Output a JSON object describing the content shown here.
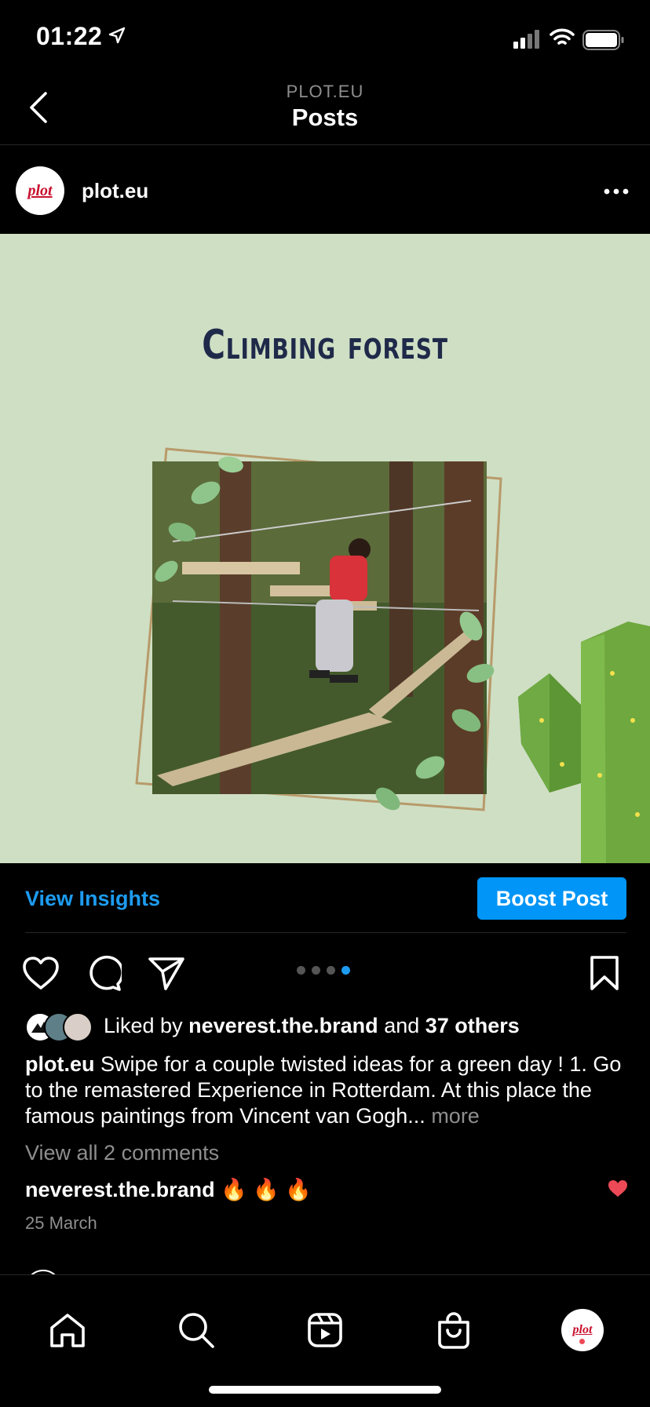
{
  "status_bar": {
    "time": "01:22"
  },
  "header": {
    "subtitle": "PLOT.EU",
    "title": "Posts"
  },
  "post": {
    "username": "plot.eu",
    "avatar_logo": "plot",
    "image_title": "Climbing forest",
    "insights_label": "View Insights",
    "boost_label": "Boost Post",
    "carousel": {
      "count": 4,
      "active_index": 3
    },
    "likes": {
      "prefix": "Liked by",
      "user": "neverest.the.brand",
      "and": "and",
      "others": "37 others"
    },
    "caption": {
      "username": "plot.eu",
      "text": "Swipe for a couple twisted ideas for a green day ! 1. Go to the remastered Experience in Rotterdam. At this place the famous paintings from Vincent van Gogh...",
      "more": "more"
    },
    "view_comments": "View all 2 comments",
    "comment": {
      "username": "neverest.the.brand",
      "text": "🔥 🔥 🔥"
    },
    "date": "25 March"
  },
  "tabbar": {
    "items": [
      "home-icon",
      "search-icon",
      "reels-icon",
      "shop-icon",
      "profile-avatar"
    ],
    "profile_logo": "plot"
  },
  "colors": {
    "accent": "#0095f6",
    "link": "#1d9bf0",
    "image_bg": "#cfdfc4",
    "title": "#1f2a4a",
    "heart": "#ed4956"
  }
}
